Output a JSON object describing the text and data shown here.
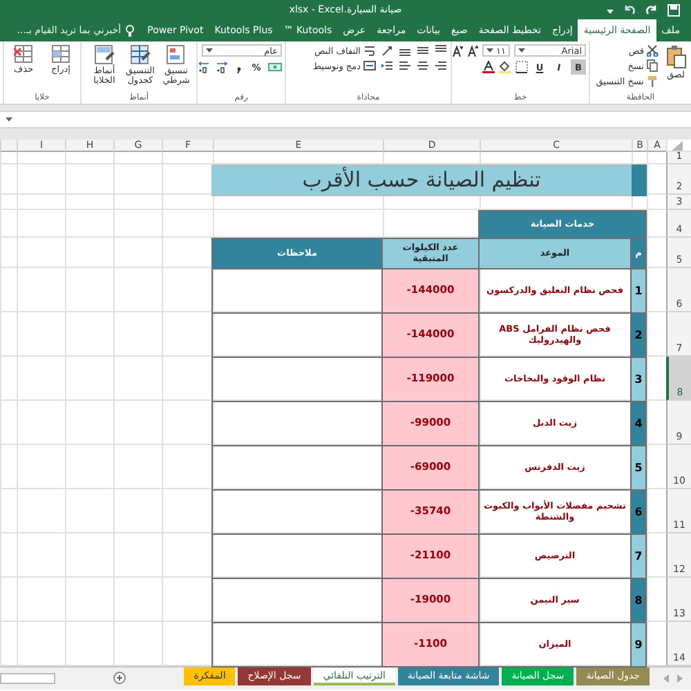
{
  "window": {
    "title": "صيانة السيارة.xlsx - Excel"
  },
  "ribbon_tabs": [
    {
      "label": "ملف",
      "selected": false
    },
    {
      "label": "الصفحة الرئيسية",
      "selected": true
    },
    {
      "label": "إدراج",
      "selected": false
    },
    {
      "label": "تخطيط الصفحة",
      "selected": false
    },
    {
      "label": "صيغ",
      "selected": false
    },
    {
      "label": "بيانات",
      "selected": false
    },
    {
      "label": "مراجعة",
      "selected": false
    },
    {
      "label": "عرض",
      "selected": false
    },
    {
      "label": "Kutools ™",
      "selected": false
    },
    {
      "label": "Kutools Plus",
      "selected": false
    },
    {
      "label": "Power Pivot",
      "selected": false
    }
  ],
  "tell_me": {
    "placeholder": "أخبرني بما تريد القيام بـ..."
  },
  "ribbon_groups": [
    {
      "kind": "clipboard",
      "label": "الحافظة",
      "items": [
        "لصق",
        "قص",
        "نسخ",
        "نسخ التنسيق"
      ]
    },
    {
      "kind": "font",
      "label": "خط",
      "font": "Arial",
      "size": "١١",
      "items": [
        "B",
        "I",
        "U"
      ]
    },
    {
      "kind": "alignment",
      "label": "محاذاة",
      "items": [
        "التفاف النص",
        "دمج وتوسيط"
      ]
    },
    {
      "kind": "number",
      "label": "رقم",
      "format": "عام",
      "items": [
        "%"
      ]
    },
    {
      "kind": "styles",
      "label": "أنماط",
      "items": [
        "تنسيق شرطي",
        "التنسيق كجدول",
        "أنماط الخلايا"
      ]
    },
    {
      "kind": "cells",
      "label": "خلايا",
      "items": [
        "إدراج",
        "حذف"
      ]
    }
  ],
  "sheet": {
    "columns": [
      "A",
      "B",
      "C",
      "D",
      "E",
      "F",
      "G",
      "H",
      "I"
    ],
    "rows": [
      {
        "label": "1",
        "selected": false
      },
      {
        "label": "2",
        "selected": false
      },
      {
        "label": "3",
        "selected": false
      },
      {
        "label": "4",
        "selected": false
      },
      {
        "label": "5",
        "selected": false
      },
      {
        "label": "6",
        "selected": false
      },
      {
        "label": "7",
        "selected": false
      },
      {
        "label": "8",
        "selected": true
      },
      {
        "label": "9",
        "selected": false
      },
      {
        "label": "10",
        "selected": false
      },
      {
        "label": "11",
        "selected": false
      },
      {
        "label": "12",
        "selected": false
      },
      {
        "label": "13",
        "selected": false
      },
      {
        "label": "14",
        "selected": false
      }
    ]
  },
  "title": "تنظيم الصيانة حسب الأقرب",
  "group_header": "خدمات الصيانة",
  "table": {
    "columns": [
      "م",
      "الموعد",
      "عدد الكيلوات المتبقية",
      "ملاحظات"
    ],
    "rows": [
      {
        "index": "1",
        "color": "#92cddc",
        "service": "فحص نظام التعليق والدركسون",
        "remaining": "-144000"
      },
      {
        "index": "2",
        "color": "#31849b",
        "service": "فحص نظام الفرامل ABS والهيدروليك",
        "remaining": "-144000"
      },
      {
        "index": "3",
        "color": "#92cddc",
        "service": "نظام الوقود والبخاخات",
        "remaining": "-119000"
      },
      {
        "index": "4",
        "color": "#31849b",
        "service": "زيت الدبل",
        "remaining": "-99000"
      },
      {
        "index": "5",
        "color": "#92cddc",
        "service": "زيت الدفرنس",
        "remaining": "-69000"
      },
      {
        "index": "6",
        "color": "#31849b",
        "service": "تشحيم مفصلات الأبواب والكبوت والشنطة",
        "remaining": "-35740"
      },
      {
        "index": "7",
        "color": "#92cddc",
        "service": "الترصيص",
        "remaining": "-21100"
      },
      {
        "index": "8",
        "color": "#31849b",
        "service": "سير التيمن",
        "remaining": "-19000"
      },
      {
        "index": "9",
        "color": "#92cddc",
        "service": "الميزان",
        "remaining": "-1100"
      }
    ]
  },
  "sheet_tabs": [
    {
      "label": "جدول الصيانة",
      "color": "#948a54",
      "selected": false
    },
    {
      "label": "سجل الصيانة",
      "color": "#00b050",
      "selected": false
    },
    {
      "label": "شاشة متابعة الصيانة",
      "color": "#31849b",
      "selected": false
    },
    {
      "label": "الترتيب التلقائي",
      "color": "#9bbb59",
      "selected": true
    },
    {
      "label": "سجل الإصلاح",
      "color": "#953735",
      "selected": false
    },
    {
      "label": "المفكرة",
      "color": "#ffc000",
      "selected": false
    }
  ]
}
